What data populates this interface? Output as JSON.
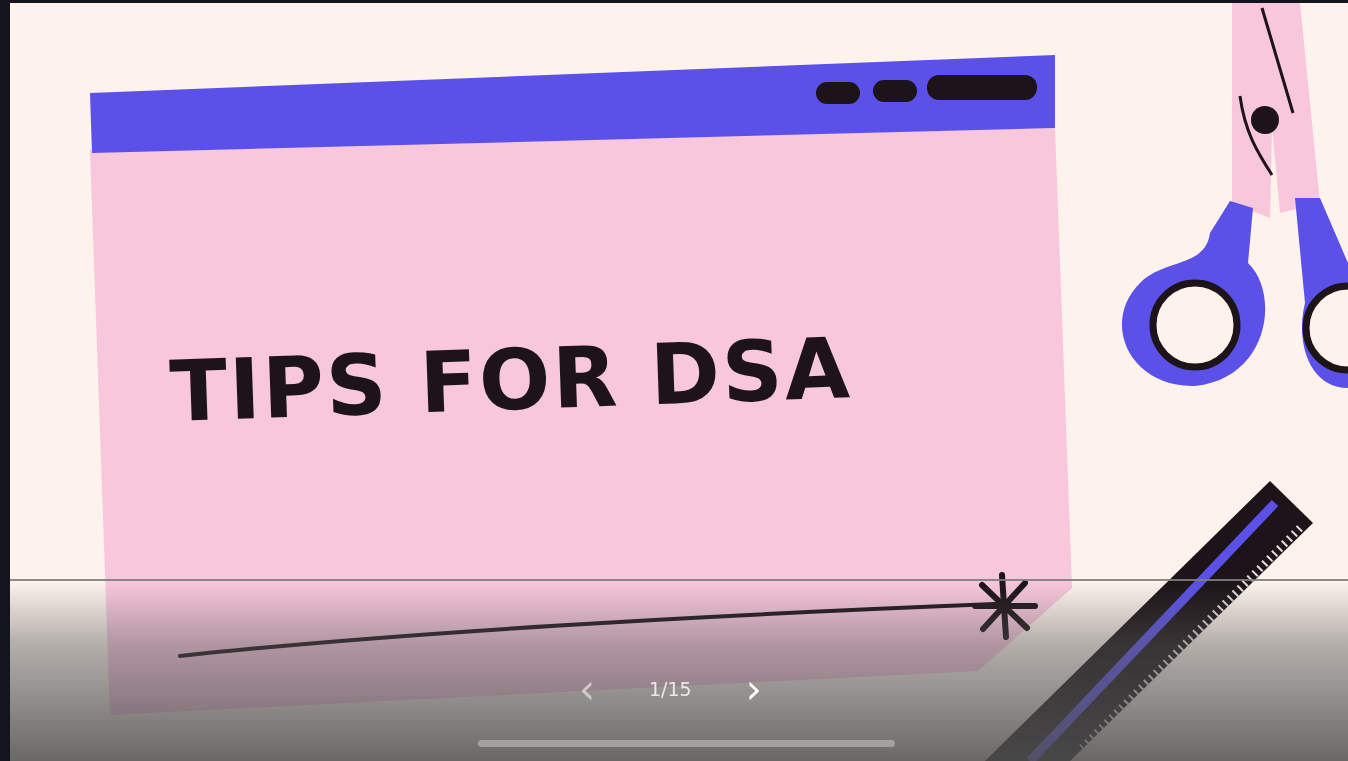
{
  "slide": {
    "title": "TIPS FOR DSA"
  },
  "viewer": {
    "prev": "‹",
    "page": "1/15",
    "next": "›"
  }
}
